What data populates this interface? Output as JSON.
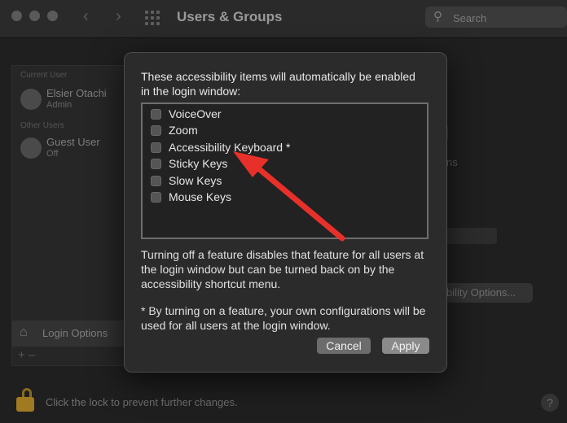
{
  "window": {
    "title": "Users & Groups",
    "back_icon": "chevron-left-icon",
    "forward_icon": "chevron-right-icon",
    "grid_icon": "grid-icon"
  },
  "search": {
    "placeholder": "Search"
  },
  "sidebar": {
    "section_current": "Current User",
    "current_user": {
      "name": "Elsier Otachi",
      "role": "Admin"
    },
    "section_other": "Other Users",
    "guest_user": {
      "name": "Guest User",
      "status": "Off"
    },
    "login_options": "Login Options",
    "add_remove": "+  –"
  },
  "background": {
    "partial_text": "ns",
    "options_button": "bility Options..."
  },
  "footer": {
    "lock_text": "Click the lock to prevent further changes.",
    "help": "?"
  },
  "dialog": {
    "header": "These accessibility items will automatically be enabled in the login window:",
    "items": [
      {
        "label": "VoiceOver",
        "checked": false
      },
      {
        "label": "Zoom",
        "checked": false
      },
      {
        "label": "Accessibility Keyboard *",
        "checked": false
      },
      {
        "label": "Sticky Keys",
        "checked": false
      },
      {
        "label": "Slow Keys",
        "checked": false
      },
      {
        "label": "Mouse Keys",
        "checked": false
      }
    ],
    "note1": "Turning off a feature disables that feature for all users at the login window but can be turned back on by the accessibility shortcut menu.",
    "note2": "* By turning on a feature, your own configurations will be used for all users at the login window.",
    "cancel": "Cancel",
    "apply": "Apply"
  },
  "annotation": {
    "arrow_color": "#e8302a"
  },
  "colors": {
    "window_bg": "#1f1f1f",
    "dialog_bg": "#2b2b2b",
    "lock": "#a07a20"
  }
}
